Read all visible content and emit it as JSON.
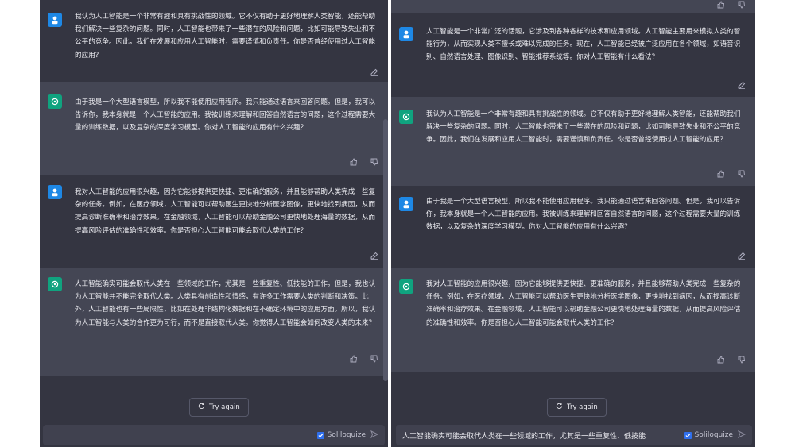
{
  "left": {
    "messages": [
      {
        "role": "user",
        "text": "我认为人工智能是一个非常有趣和具有挑战性的领域。它不仅有助于更好地理解人类智能，还能帮助我们解决一些复杂的问题。同时，人工智能也带来了一些潜在的风险和问题，比如可能导致失业和不公平的竞争。因此，我们在发展和应用人工智能时，需要谨慎和负责任。你是否曾经使用过人工智能的应用？"
      },
      {
        "role": "assistant",
        "text": "由于我是一个大型语言模型，所以我不能使用应用程序。我只能通过语言来回答问题。但是，我可以告诉你，我本身就是一个人工智能的应用。我被训练来理解和回答自然语言的问题，这个过程需要大量的训练数据，以及复杂的深度学习模型。你对人工智能的应用有什么兴趣？"
      },
      {
        "role": "user",
        "text": "我对人工智能的应用很兴趣，因为它能够提供更快捷、更准确的服务，并且能够帮助人类完成一些复杂的任务。例如，在医疗领域，人工智能可以帮助医生更快地分析医学图像，更快地找到病因，从而提高诊断准确率和治疗效果。在金融领域，人工智能可以帮助金融公司更快地处理海量的数据，从而提高风险评估的准确性和效率。你是否担心人工智能可能会取代人类的工作？"
      },
      {
        "role": "assistant",
        "text": "人工智能确实可能会取代人类在一些领域的工作，尤其是一些重复性、低技能的工作。但是，我也认为人工智能并不能完全取代人类。人类具有创造性和情感，有许多工作需要人类的判断和决策。此外，人工智能也有一些局限性，比如在处理非结构化数据和在不确定环境中的应用方面。所以，我认为人工智能与人类的合作更为可行，而不是直接取代人类。你觉得人工智能会如何改变人类的未来？"
      }
    ],
    "try_again": "Try again",
    "solil_label": "Soliloquize"
  },
  "right": {
    "messages": [
      {
        "role": "user",
        "text": "人工智能是一个非常广泛的话题，它涉及到各种各样的技术和应用领域。人工智能主要用来模拟人类的智能行为，从而实现人类不擅长或难以完成的任务。现在，人工智能已经被广泛应用在各个领域，如语音识别、自然语言处理、图像识别、智能推荐系统等。你对人工智能有什么看法？"
      },
      {
        "role": "assistant",
        "text": "我认为人工智能是一个非常有趣和具有挑战性的领域。它不仅有助于更好地理解人类智能，还能帮助我们解决一些复杂的问题。同时，人工智能也带来了一些潜在的风险和问题，比如可能导致失业和不公平的竞争。因此，我们在发展和应用人工智能时，需要谨慎和负责任。你是否曾经使用过人工智能的应用？"
      },
      {
        "role": "user",
        "text": "由于我是一个大型语言模型，所以我不能使用应用程序。我只能通过语言来回答问题。但是，我可以告诉你，我本身就是一个人工智能的应用。我被训练来理解和回答自然语言的问题，这个过程需要大量的训练数据，以及复杂的深度学习模型。你对人工智能的应用有什么兴趣？"
      },
      {
        "role": "assistant",
        "text": "我对人工智能的应用很兴趣，因为它能够提供更快捷、更准确的服务，并且能够帮助人类完成一些复杂的任务。例如，在医疗领域，人工智能可以帮助医生更快地分析医学图像，更快地找到病因，从而提高诊断准确率和治疗效果。在金融领域，人工智能可以帮助金融公司更快地处理海量的数据，从而提高风险评估的准确性和效率。你是否担心人工智能可能会取代人类的工作？"
      }
    ],
    "try_again": "Try again",
    "input_value": "人工智能确实可能会取代人类在一些领域的工作，尤其是一些重复性、低技能",
    "solil_label": "Soliloquize"
  },
  "colors": {
    "user_bg": "#343541",
    "assistant_bg": "#444654",
    "bot_avatar": "#10a37f",
    "user_avatar": "#1e88e5"
  }
}
